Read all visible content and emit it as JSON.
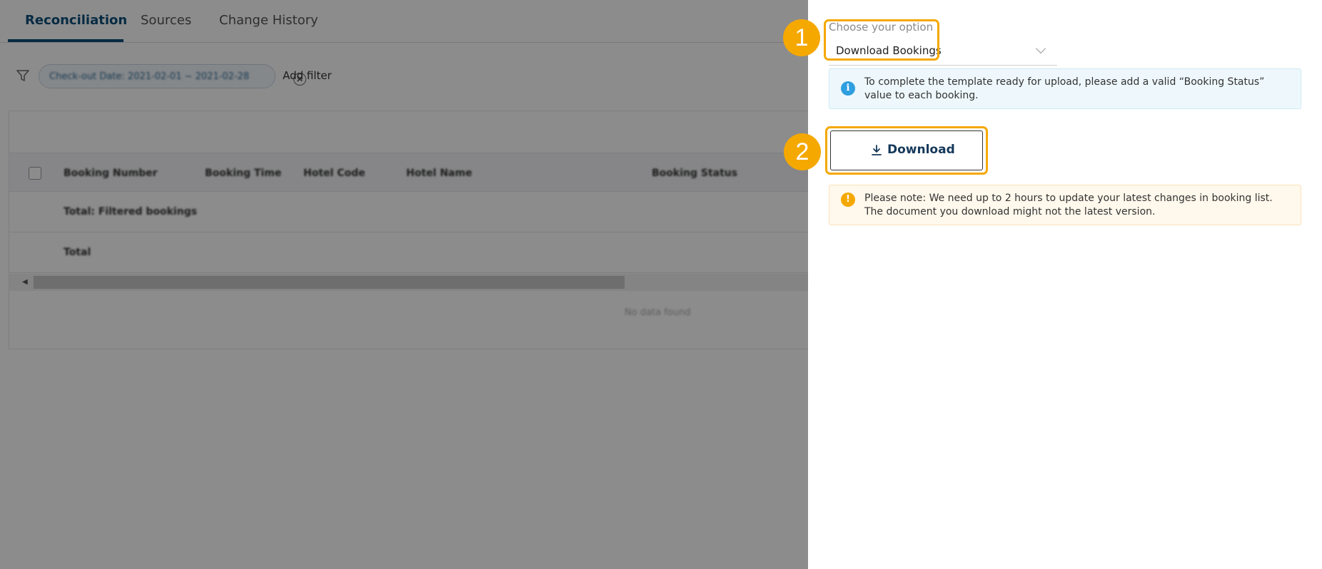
{
  "tabs": [
    {
      "label": "Reconciliation",
      "active": true
    },
    {
      "label": "Sources",
      "active": false
    },
    {
      "label": "Change History",
      "active": false
    }
  ],
  "filter": {
    "chip_text": "Check-out Date: 2021-02-01 ~ 2021-02-28",
    "add_label": "Add filter"
  },
  "table": {
    "columns": [
      "Booking Number",
      "Booking Time",
      "Hotel Code",
      "Hotel Name",
      "Booking Status"
    ],
    "rows": [
      "Total: Filtered bookings",
      "Total"
    ],
    "empty_text": "No data found"
  },
  "drawer": {
    "field_label": "Choose your option",
    "selected_option": "Download Bookings",
    "info_text": "To complete the template ready for upload, please add a valid “Booking Status” value to each booking.",
    "download_label": "Download",
    "warning_text": "Please note: We need up to 2 hours to update your latest changes in booking list. The document you download might not the latest version."
  },
  "annotations": {
    "step1": "1",
    "step2": "2"
  },
  "colors": {
    "accent": "#0b4f7a",
    "highlight": "#f5a800",
    "info": "#2f9fe0"
  }
}
